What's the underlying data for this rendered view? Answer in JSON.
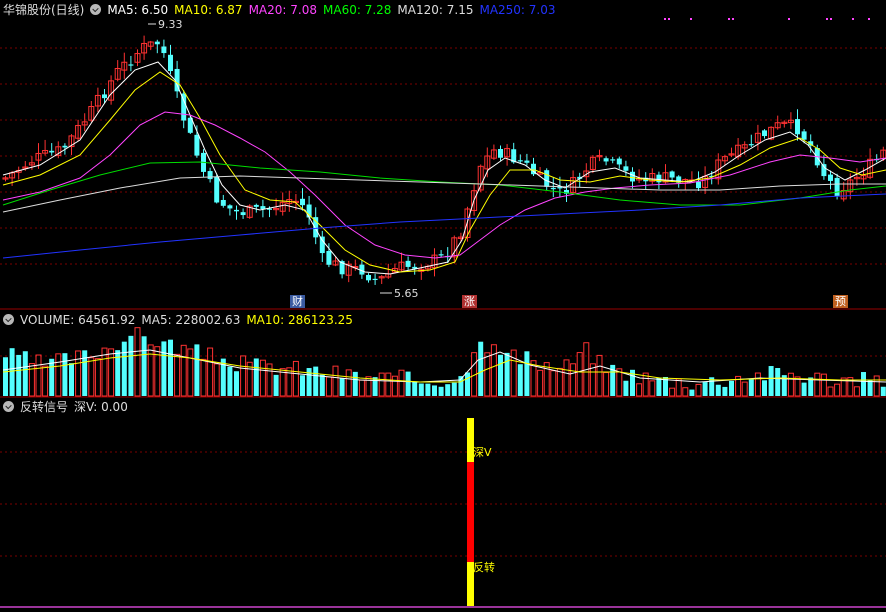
{
  "price": {
    "title": "华锦股份(日线)",
    "ma": [
      {
        "label": "MA5: 6.50",
        "color": "#ffffff"
      },
      {
        "label": "MA10: 6.87",
        "color": "#ffff00"
      },
      {
        "label": "MA20: 7.08",
        "color": "#ff44ff"
      },
      {
        "label": "MA60: 7.28",
        "color": "#00ff00"
      },
      {
        "label": "MA120: 7.15",
        "color": "#dddddd"
      },
      {
        "label": "MA250: 7.03",
        "color": "#2233ff"
      }
    ],
    "high_label": "9.33",
    "low_label": "5.65",
    "tags": [
      {
        "text": "财",
        "bg": "#3a5aa0"
      },
      {
        "text": "涨",
        "bg": "#b03030"
      },
      {
        "text": "预",
        "bg": "#c06020"
      }
    ]
  },
  "volume": {
    "title": "VOLUME: 64561.92",
    "ma5": "MA5: 228002.63",
    "ma10": "MA10: 286123.25"
  },
  "signal": {
    "title": "反转信号",
    "value": "深V: 0.00",
    "label_v": "深V",
    "label_rev": "反转"
  },
  "chart_data": [
    {
      "type": "candlestick",
      "series": [
        {
          "name": "MA5",
          "value": 6.5
        },
        {
          "name": "MA10",
          "value": 6.87
        },
        {
          "name": "MA20",
          "value": 7.08
        },
        {
          "name": "MA60",
          "value": 7.28
        },
        {
          "name": "MA120",
          "value": 7.15
        },
        {
          "name": "MA250",
          "value": 7.03
        }
      ],
      "annotations": [
        {
          "text": "9.33",
          "type": "high"
        },
        {
          "text": "5.65",
          "type": "low"
        }
      ]
    },
    {
      "type": "bar",
      "series": [
        {
          "name": "VOLUME",
          "value": 64561.92
        },
        {
          "name": "MA5",
          "value": 228002.63
        },
        {
          "name": "MA10",
          "value": 286123.25
        }
      ]
    },
    {
      "type": "bar",
      "series": [
        {
          "name": "深V",
          "value": 0.0
        }
      ]
    }
  ]
}
